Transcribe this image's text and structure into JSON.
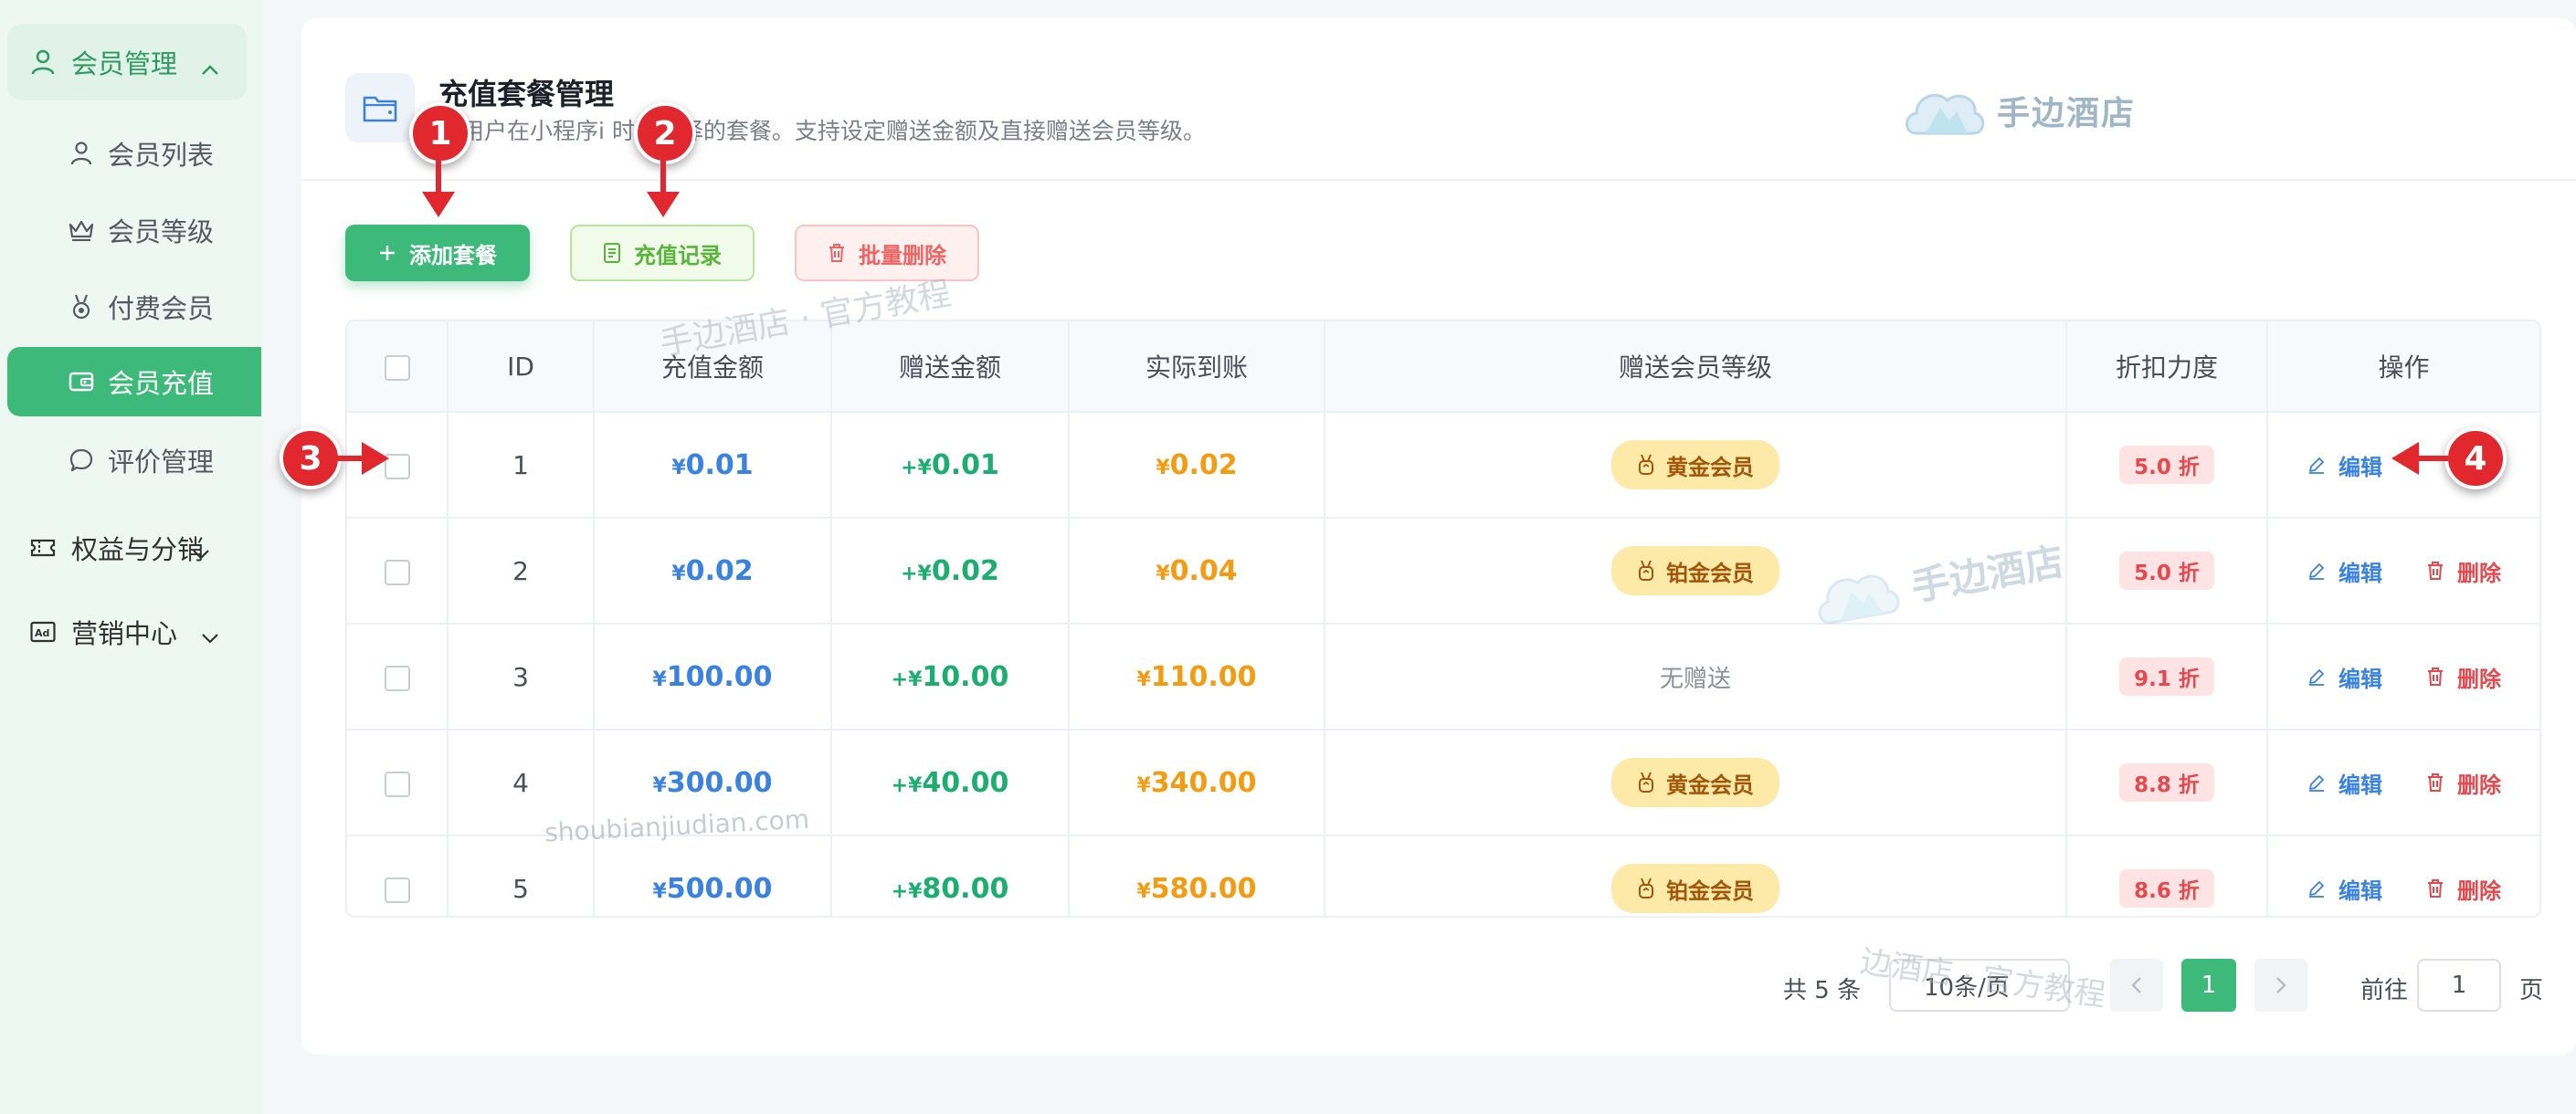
{
  "sidebar": {
    "member_group": "会员管理",
    "items": [
      {
        "label": "会员列表",
        "icon": "user-icon"
      },
      {
        "label": "会员等级",
        "icon": "crown-icon"
      },
      {
        "label": "付费会员",
        "icon": "medal-icon"
      },
      {
        "label": "会员充值",
        "icon": "wallet-icon",
        "active": true
      },
      {
        "label": "评价管理",
        "icon": "chat-icon"
      }
    ],
    "group_benefits": "权益与分销",
    "group_marketing": "营销中心"
  },
  "header": {
    "title": "充值套餐管理",
    "subtitle": "置用户在小程序i     时可选择的套餐。支持设定赠送金额及直接赠送会员等级。",
    "logo_text": "手边酒店"
  },
  "toolbar": {
    "add_label": "添加套餐",
    "records_label": "充值记录",
    "batch_delete_label": "批量删除"
  },
  "table": {
    "columns": [
      "ID",
      "充值金额",
      "赠送金额",
      "实际到账",
      "赠送会员等级",
      "折扣力度",
      "操作"
    ],
    "rows": [
      {
        "id": "1",
        "amount": "0.01",
        "gift": "0.01",
        "actual": "0.02",
        "level": "黄金会员",
        "discount": "5.0 折",
        "has_delete": false
      },
      {
        "id": "2",
        "amount": "0.02",
        "gift": "0.02",
        "actual": "0.04",
        "level": "铂金会员",
        "discount": "5.0 折",
        "has_delete": true
      },
      {
        "id": "3",
        "amount": "100.00",
        "gift": "10.00",
        "actual": "110.00",
        "level": "无赠送",
        "discount": "9.1 折",
        "has_delete": true
      },
      {
        "id": "4",
        "amount": "300.00",
        "gift": "40.00",
        "actual": "340.00",
        "level": "黄金会员",
        "discount": "8.8 折",
        "has_delete": true
      },
      {
        "id": "5",
        "amount": "500.00",
        "gift": "80.00",
        "actual": "580.00",
        "level": "铂金会员",
        "discount": "8.6 折",
        "has_delete": true
      }
    ],
    "currency": "¥",
    "gift_prefix": "+",
    "edit_label": "编辑",
    "delete_label": "删除"
  },
  "pagination": {
    "total": "共 5 条",
    "page_size": "10条/页",
    "current_page": "1",
    "goto_label": "前往",
    "goto_value": "1",
    "page_suffix": "页"
  },
  "watermarks": {
    "text_top": "手边酒店 · 官方教程",
    "text_bottom": "边酒店 · 官方教程",
    "url": "shoubianjiudian.com",
    "logo_text": "手边酒店"
  },
  "callouts": [
    "1",
    "2",
    "3",
    "4"
  ],
  "colors": {
    "primary": "#3dba7a",
    "amount_blue": "#3a82e0",
    "gift_green": "#1cae6e",
    "actual_orange": "#f39c12",
    "danger": "#e5484d"
  }
}
